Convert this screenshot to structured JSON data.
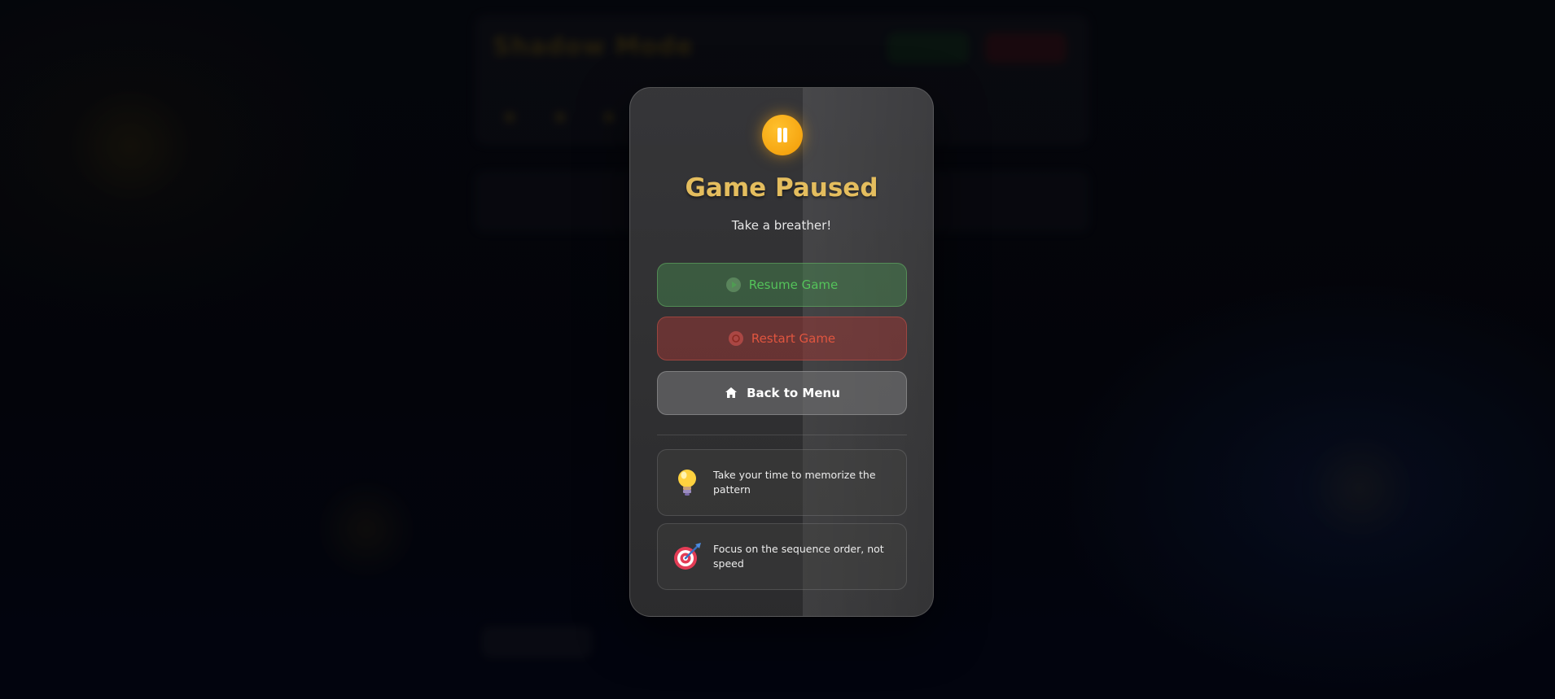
{
  "background": {
    "title": "Shadow Mode"
  },
  "modal": {
    "title": "Game Paused",
    "subtitle": "Take a breather!",
    "buttons": {
      "resume": "Resume Game",
      "restart": "Restart Game",
      "menu": "Back to Menu"
    },
    "tips": [
      {
        "icon": "lightbulb-icon",
        "text": "Take your time to memorize the pattern"
      },
      {
        "icon": "target-icon",
        "text": "Focus on the sequence order, not speed"
      }
    ]
  },
  "colors": {
    "accent": "#f5a50a",
    "title": "#e4bd5e",
    "resume": "#54c35a",
    "restart": "#e0553f"
  }
}
